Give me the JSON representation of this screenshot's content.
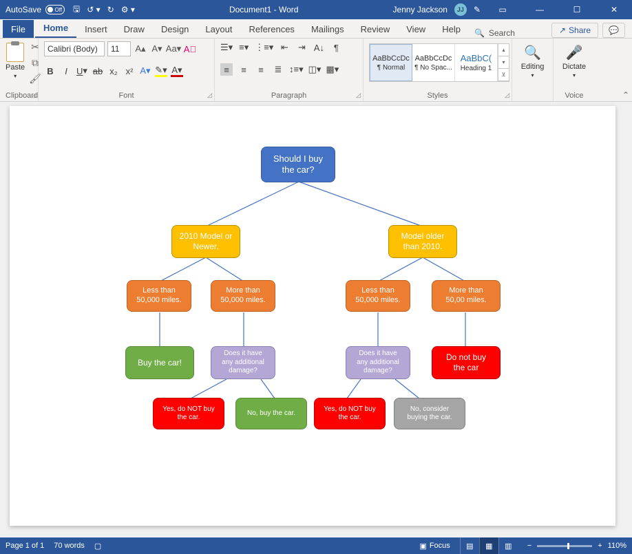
{
  "titlebar": {
    "autosave": "AutoSave",
    "autosave_state": "Off",
    "doc_title": "Document1 - Word",
    "user": "Jenny Jackson",
    "initials": "JJ"
  },
  "tabs": {
    "file": "File",
    "home": "Home",
    "insert": "Insert",
    "draw": "Draw",
    "design": "Design",
    "layout": "Layout",
    "references": "References",
    "mailings": "Mailings",
    "review": "Review",
    "view": "View",
    "help": "Help",
    "search": "Search",
    "share": "Share"
  },
  "ribbon": {
    "clipboard": {
      "label": "Clipboard",
      "paste": "Paste"
    },
    "font": {
      "label": "Font",
      "name": "Calibri (Body)",
      "size": "11"
    },
    "paragraph": {
      "label": "Paragraph"
    },
    "styles": {
      "label": "Styles",
      "items": [
        {
          "preview": "AaBbCcDc",
          "name": "¶ Normal"
        },
        {
          "preview": "AaBbCcDc",
          "name": "¶ No Spac..."
        },
        {
          "preview": "AaBbC(",
          "name": "Heading 1"
        }
      ]
    },
    "editing": {
      "label": "Editing"
    },
    "voice": {
      "label": "Voice",
      "dictate": "Dictate"
    }
  },
  "diagram": {
    "root": "Should I buy the car?",
    "l1a": "2010 Model or Newer.",
    "l1b": "Model older than 2010.",
    "l2a": "Less than 50,000 miles.",
    "l2b": "More than 50,000 miles.",
    "l2c": "Less than 50,000 miles.",
    "l2d": "More than 50,00 miles.",
    "l3a": "Buy the car!",
    "l3b": "Does it have any additional damage?",
    "l3c": "Does it have any additional damage?",
    "l3d": "Do not buy the car",
    "l4a": "Yes, do NOT buy the car.",
    "l4b": "No, buy the car.",
    "l4c": "Yes, do NOT buy the car.",
    "l4d": "No, consider buying the car."
  },
  "status": {
    "page": "Page 1 of 1",
    "words": "70 words",
    "focus": "Focus",
    "zoom": "110%"
  }
}
